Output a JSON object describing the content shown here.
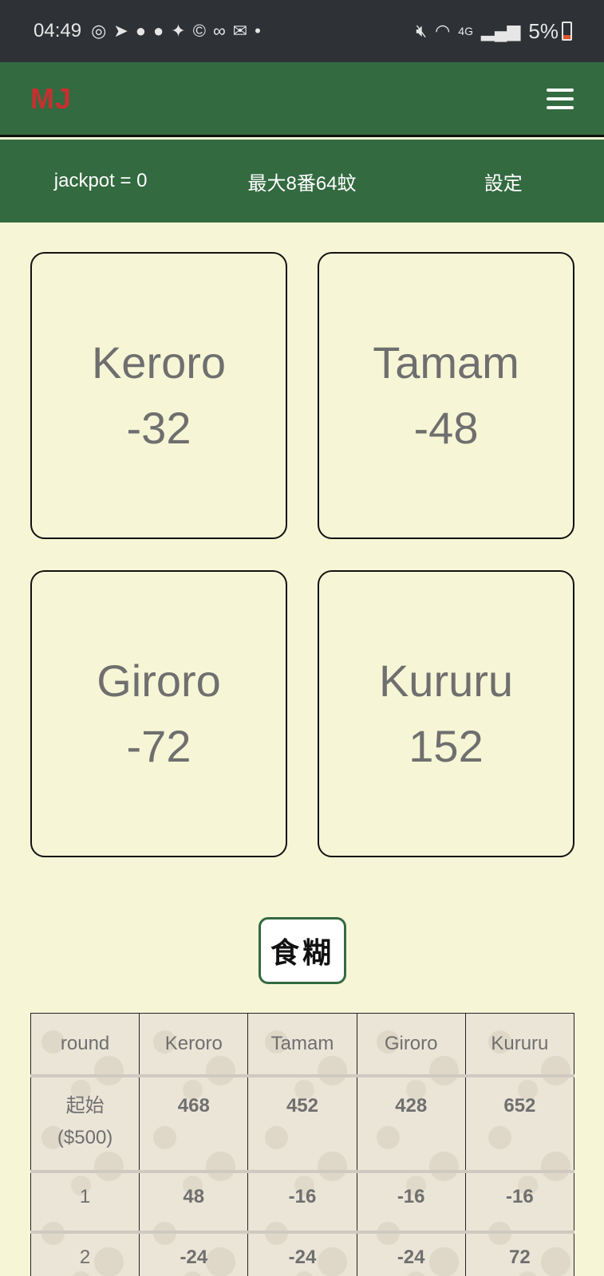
{
  "status_bar": {
    "time": "04:49",
    "battery": "5%",
    "network": "4G"
  },
  "app": {
    "brand": "MJ"
  },
  "subbar": {
    "jackpot": "jackpot = 0",
    "max": "最大8番64蚊",
    "settings": "設定"
  },
  "players": [
    {
      "name": "Keroro",
      "score": "-32"
    },
    {
      "name": "Tamam",
      "score": "-48"
    },
    {
      "name": "Giroro",
      "score": "-72"
    },
    {
      "name": "Kururu",
      "score": "152"
    }
  ],
  "action_button": {
    "label": "食糊"
  },
  "table": {
    "headers": [
      "round",
      "Keroro",
      "Tamam",
      "Giroro",
      "Kururu"
    ],
    "rows": [
      {
        "round_line1": "起始",
        "round_line2": "($500)",
        "values": [
          "468",
          "452",
          "428",
          "652"
        ]
      },
      {
        "round_line1": "1",
        "round_line2": "",
        "values": [
          "48",
          "-16",
          "-16",
          "-16"
        ]
      },
      {
        "round_line1": "2",
        "round_line2": "",
        "values": [
          "-24",
          "-24",
          "-24",
          "72"
        ]
      }
    ]
  },
  "colors": {
    "status_bar": "#2e3136",
    "app_bar": "#336a40",
    "brand": "#c53030",
    "background": "#f6f6d6"
  }
}
